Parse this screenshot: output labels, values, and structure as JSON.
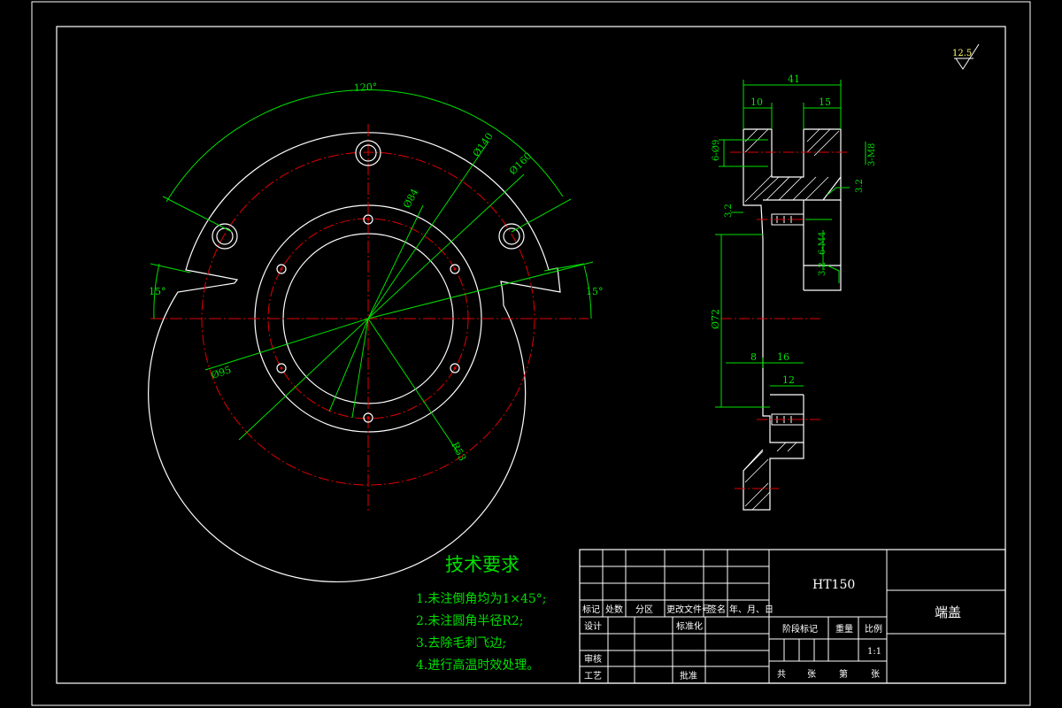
{
  "roughness": "12.5",
  "front_view": {
    "angle_top": "120°",
    "angle_left": "15°",
    "angle_right": "15°",
    "dim_d140": "Ø140",
    "dim_d160": "Ø160",
    "dim_d84": "Ø84",
    "dim_d95": "Ø95",
    "dim_r53": "R53"
  },
  "side_view": {
    "dim_41": "41",
    "dim_10": "10",
    "dim_15": "15",
    "dim_8": "8",
    "dim_16": "16",
    "dim_12": "12",
    "dim_6d9": "6-Ø9",
    "dim_3m8": "3-M8",
    "dim_6m4": "6-M4",
    "dim_d72": "Ø72",
    "rough_a": "3.2",
    "rough_b": "3.2",
    "rough_c": "3.2"
  },
  "tech_requirements": {
    "title": "技术要求",
    "items": [
      "1.未注倒角均为1×45°;",
      "2.未注圆角半径R2;",
      "3.去除毛刺飞边;",
      "4.进行高温时效处理。"
    ]
  },
  "title_block": {
    "material": "HT150",
    "part_name": "端盖",
    "scale": "1:1",
    "header": [
      "标记",
      "处数",
      "分区",
      "更改文件号",
      "签名",
      "年、月、日"
    ],
    "design": "设计",
    "standardize": "标准化",
    "review": "审核",
    "process": "工艺",
    "approve": "批准",
    "stage_mark": "阶段标记",
    "weight": "重量",
    "scale_label": "比例",
    "total": "共",
    "sheets_a": "张",
    "page": "第",
    "sheets_b": "张"
  }
}
